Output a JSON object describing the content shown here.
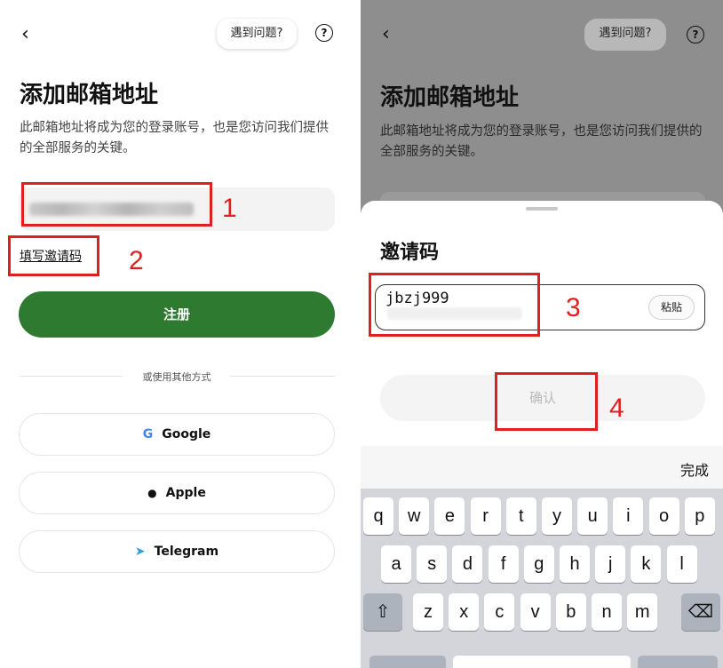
{
  "left": {
    "help_label": "遇到问题?",
    "help_icon_text": "?",
    "back_glyph": "‹",
    "title": "添加邮箱地址",
    "description": "此邮箱地址将成为您的登录账号，也是您访问我们提供的全部服务的关键。",
    "invite_link": "填写邀请码",
    "register_label": "注册",
    "divider_text": "或使用其他方式",
    "social": [
      {
        "label": "Google",
        "icon": "google-icon",
        "glyph": "G",
        "color": "#4285f4"
      },
      {
        "label": "Apple",
        "icon": "apple-icon",
        "glyph": "●",
        "color": "#111111"
      },
      {
        "label": "Telegram",
        "icon": "telegram-icon",
        "glyph": "➤",
        "color": "#2aa3e0"
      }
    ],
    "annotations": [
      "1",
      "2"
    ]
  },
  "right": {
    "help_label": "遇到问题?",
    "help_icon_text": "?",
    "back_glyph": "‹",
    "title": "添加邮箱地址",
    "description": "此邮箱地址将成为您的登录账号，也是您访问我们提供的全部服务的关键。",
    "sheet_title": "邀请码",
    "code_value": "jbzj999",
    "paste_label": "粘贴",
    "confirm_label": "确认",
    "annotations": [
      "3",
      "4"
    ],
    "keyboard": {
      "done_label": "完成",
      "row1": [
        "q",
        "w",
        "e",
        "r",
        "t",
        "y",
        "u",
        "i",
        "o",
        "p"
      ],
      "row2": [
        "a",
        "s",
        "d",
        "f",
        "g",
        "h",
        "j",
        "k",
        "l"
      ],
      "row3": [
        "z",
        "x",
        "c",
        "v",
        "b",
        "n",
        "m"
      ],
      "shift_glyph": "⇧",
      "delete_glyph": "⌫"
    }
  },
  "colors": {
    "accent_green": "#2e7a30",
    "annotation_red": "#e02020",
    "overlay_gray": "#8e8e8e"
  }
}
